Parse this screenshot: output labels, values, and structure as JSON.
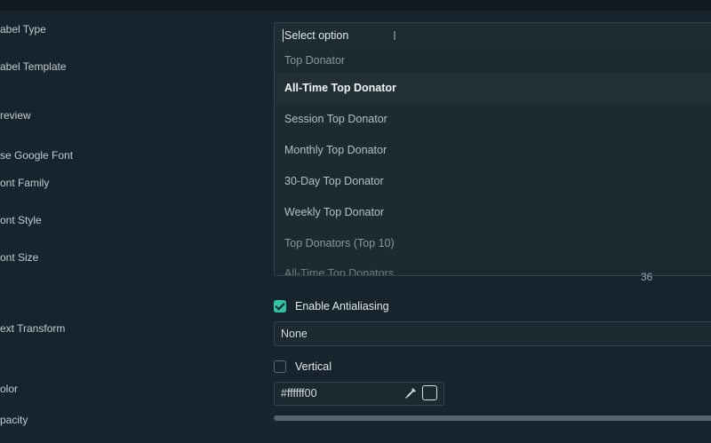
{
  "labels": {
    "label_type": "abel Type",
    "label_template": "abel Template",
    "preview": "review",
    "use_google_font": "se Google Font",
    "font_family": "ont Family",
    "font_style": "ont Style",
    "font_size": "ont Size",
    "text_transform": "ext Transform",
    "color": "olor",
    "opacity": "pacity"
  },
  "dropdown": {
    "search_placeholder": "Select option",
    "options": [
      {
        "label": "Top Donator",
        "kind": "group-header"
      },
      {
        "label": "All-Time Top Donator",
        "kind": "selected"
      },
      {
        "label": "Session Top Donator",
        "kind": "normal"
      },
      {
        "label": "Monthly Top Donator",
        "kind": "normal"
      },
      {
        "label": "30-Day Top Donator",
        "kind": "normal"
      },
      {
        "label": "Weekly Top Donator",
        "kind": "normal"
      },
      {
        "label": "Top Donators (Top 10)",
        "kind": "muted"
      },
      {
        "label": "All-Time Top Donators",
        "kind": "partial"
      }
    ]
  },
  "font_size_value": "36",
  "antialiasing": {
    "label": "Enable Antialiasing",
    "checked": true
  },
  "text_transform_value": "None",
  "vertical": {
    "label": "Vertical",
    "checked": false
  },
  "color_value": "#ffffff00",
  "colors": {
    "background": "#17242d",
    "accent": "#31c3a2",
    "field_bg": "#1c2930",
    "border": "#34444e"
  },
  "icons": {
    "picker": "eyedropper-icon",
    "cursor": "text-cursor-icon"
  }
}
